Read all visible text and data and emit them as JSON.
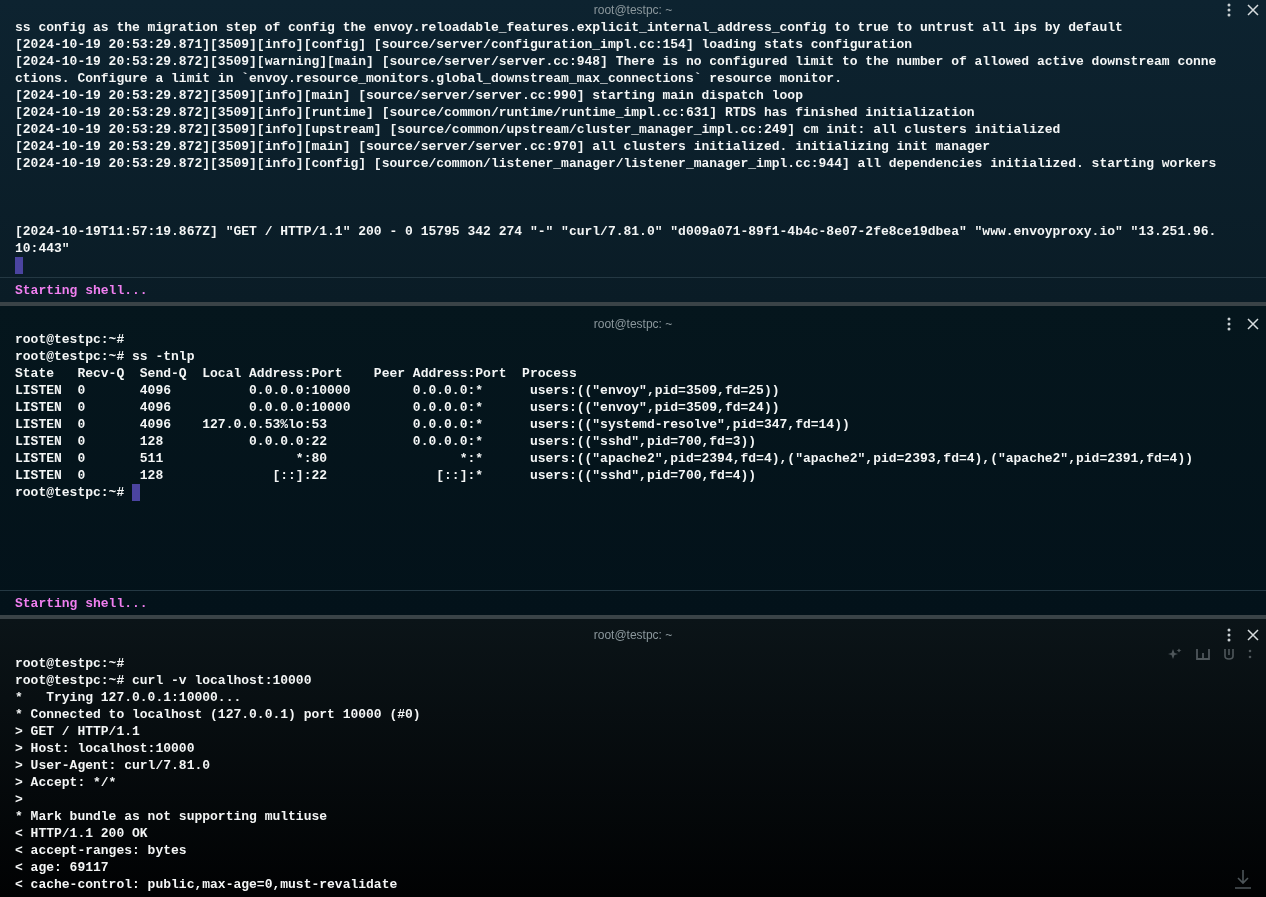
{
  "panes": [
    {
      "title": "root@testpc: ~",
      "blocks": [
        [
          {
            "kind": "text",
            "text": "ss config as the migration step of config the envoy.reloadable_features.explicit_internal_address_config to true to untrust all ips by default"
          },
          {
            "kind": "text",
            "text": "[2024-10-19 20:53:29.871][3509][info][config] [source/server/configuration_impl.cc:154] loading stats configuration"
          },
          {
            "kind": "text",
            "text": "[2024-10-19 20:53:29.872][3509][warning][main] [source/server/server.cc:948] There is no configured limit to the number of allowed active downstream conne"
          },
          {
            "kind": "text",
            "text": "ctions. Configure a limit in `envoy.resource_monitors.global_downstream_max_connections` resource monitor."
          },
          {
            "kind": "text",
            "text": "[2024-10-19 20:53:29.872][3509][info][main] [source/server/server.cc:990] starting main dispatch loop"
          },
          {
            "kind": "text",
            "text": "[2024-10-19 20:53:29.872][3509][info][runtime] [source/common/runtime/runtime_impl.cc:631] RTDS has finished initialization"
          },
          {
            "kind": "text",
            "text": "[2024-10-19 20:53:29.872][3509][info][upstream] [source/common/upstream/cluster_manager_impl.cc:249] cm init: all clusters initialized"
          },
          {
            "kind": "text",
            "text": "[2024-10-19 20:53:29.872][3509][info][main] [source/server/server.cc:970] all clusters initialized. initializing init manager"
          },
          {
            "kind": "text",
            "text": "[2024-10-19 20:53:29.872][3509][info][config] [source/common/listener_manager/listener_manager_impl.cc:944] all dependencies initialized. starting workers"
          }
        ],
        [
          {
            "kind": "text",
            "text": "[2024-10-19T11:57:19.867Z] \"GET / HTTP/1.1\" 200 - 0 15795 342 274 \"-\" \"curl/7.81.0\" \"d009a071-89f1-4b4c-8e07-2fe8ce19dbea\" \"www.envoyproxy.io\" \"13.251.96."
          },
          {
            "kind": "text",
            "text": "10:443\""
          },
          {
            "kind": "cursor"
          }
        ]
      ],
      "status": "Starting shell..."
    },
    {
      "title": "root@testpc: ~",
      "blocks": [
        [
          {
            "kind": "text",
            "text": "root@testpc:~#"
          },
          {
            "kind": "text",
            "text": "root@testpc:~# ss -tnlp"
          },
          {
            "kind": "text",
            "text": "State   Recv-Q  Send-Q  Local Address:Port    Peer Address:Port  Process"
          },
          {
            "kind": "text",
            "text": "LISTEN  0       4096          0.0.0.0:10000        0.0.0.0:*      users:((\"envoy\",pid=3509,fd=25))"
          },
          {
            "kind": "text",
            "text": "LISTEN  0       4096          0.0.0.0:10000        0.0.0.0:*      users:((\"envoy\",pid=3509,fd=24))"
          },
          {
            "kind": "text",
            "text": "LISTEN  0       4096    127.0.0.53%lo:53           0.0.0.0:*      users:((\"systemd-resolve\",pid=347,fd=14))"
          },
          {
            "kind": "text",
            "text": "LISTEN  0       128           0.0.0.0:22           0.0.0.0:*      users:((\"sshd\",pid=700,fd=3))"
          },
          {
            "kind": "text",
            "text": "LISTEN  0       511                 *:80                 *:*      users:((\"apache2\",pid=2394,fd=4),(\"apache2\",pid=2393,fd=4),(\"apache2\",pid=2391,fd=4))"
          },
          {
            "kind": "text",
            "text": "LISTEN  0       128              [::]:22              [::]:*      users:((\"sshd\",pid=700,fd=4))"
          },
          {
            "kind": "prompt",
            "text": "root@testpc:~# "
          }
        ]
      ],
      "status": "Starting shell..."
    },
    {
      "title": "root@testpc: ~",
      "toolbar": true,
      "jump_to_bottom": true,
      "blocks": [
        [
          {
            "kind": "text",
            "text": "root@testpc:~#"
          },
          {
            "kind": "text",
            "text": "root@testpc:~# curl -v localhost:10000"
          },
          {
            "kind": "text",
            "text": "*   Trying 127.0.0.1:10000..."
          },
          {
            "kind": "text",
            "text": "* Connected to localhost (127.0.0.1) port 10000 (#0)"
          },
          {
            "kind": "text",
            "text": "> GET / HTTP/1.1"
          },
          {
            "kind": "text",
            "text": "> Host: localhost:10000"
          },
          {
            "kind": "text",
            "text": "> User-Agent: curl/7.81.0"
          },
          {
            "kind": "text",
            "text": "> Accept: */*"
          },
          {
            "kind": "text",
            "text": ">"
          },
          {
            "kind": "text",
            "text": "* Mark bundle as not supporting multiuse"
          },
          {
            "kind": "text",
            "text": "< HTTP/1.1 200 OK"
          },
          {
            "kind": "text",
            "text": "< accept-ranges: bytes"
          },
          {
            "kind": "text",
            "text": "< age: 69117"
          },
          {
            "kind": "text",
            "text": "< cache-control: public,max-age=0,must-revalidate"
          }
        ]
      ]
    }
  ]
}
